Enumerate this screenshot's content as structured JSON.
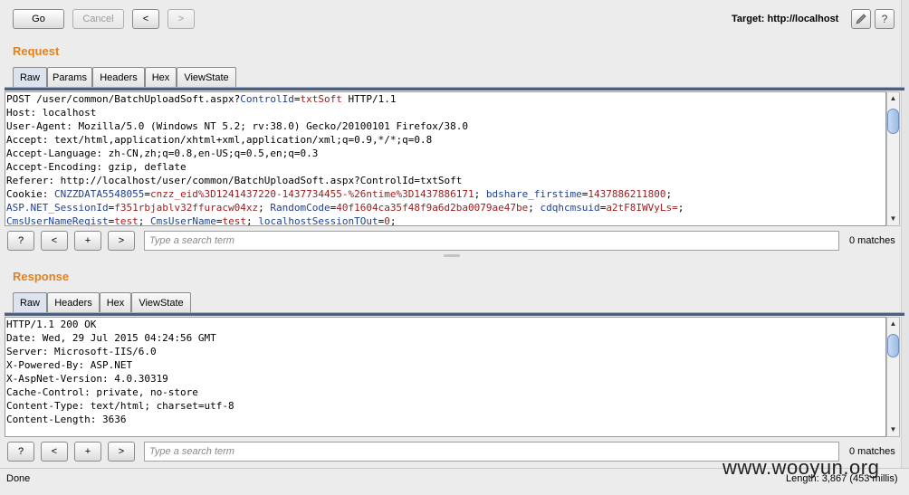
{
  "toolbar": {
    "go_label": "Go",
    "cancel_label": "Cancel",
    "back_label": "<",
    "forward_label": ">",
    "target_label": "Target: http://localhost",
    "edit_icon": "pencil-icon",
    "help_label": "?"
  },
  "request": {
    "title": "Request",
    "tabs": [
      "Raw",
      "Params",
      "Headers",
      "Hex",
      "ViewState"
    ],
    "active_tab": "Raw",
    "lines": [
      "POST /user/common/BatchUploadSoft.aspx?",
      "Host: localhost",
      "User-Agent: Mozilla/5.0 (Windows NT 5.2; rv:38.0) Gecko/20100101 Firefox/38.0",
      "Accept: text/html,application/xhtml+xml,application/xml;q=0.9,*/*;q=0.8",
      "Accept-Language: zh-CN,zh;q=0.8,en-US;q=0.5,en;q=0.3",
      "Accept-Encoding: gzip, deflate",
      "Referer: http://localhost/user/common/BatchUploadSoft.aspx?ControlId=txtSoft"
    ],
    "line0_param_name": "ControlId",
    "line0_param_eq": "=",
    "line0_param_value": "txtSoft",
    "line0_protocol": " HTTP/1.1",
    "cookie_prefix": "Cookie: ",
    "cookies": {
      "c1_name": "CNZZDATA5548055",
      "c1_value": "cnzz_eid%3D1241437220-1437734455-%26ntime%3D1437886171",
      "c2_name": "bdshare_firstime",
      "c2_value": "1437886211800",
      "c3_name": "ASP.NET_SessionId",
      "c3_value": "f351rbjablv32ffuracw04xz",
      "c4_name": "RandomCode",
      "c4_value": "40f1604ca35f48f9a6d2ba0079ae47be",
      "c5_name": "cdqhcmsuid",
      "c5_value": "a2tF8IWVyLs=",
      "c6_name": "CmsUserNameRegist",
      "c6_value": "test",
      "c7_name": "CmsUserName",
      "c7_value": "test",
      "c8_name": "localhostSessionTOut",
      "c8_value": "0"
    },
    "search": {
      "help_label": "?",
      "prev_label": "<",
      "add_label": "+",
      "next_label": ">",
      "placeholder": "Type a search term",
      "matches": "0 matches"
    }
  },
  "response": {
    "title": "Response",
    "tabs": [
      "Raw",
      "Headers",
      "Hex",
      "ViewState"
    ],
    "active_tab": "Raw",
    "lines": [
      "HTTP/1.1 200 OK",
      "Date: Wed, 29 Jul 2015 04:24:56 GMT",
      "Server: Microsoft-IIS/6.0",
      "X-Powered-By: ASP.NET",
      "X-AspNet-Version: 4.0.30319",
      "Cache-Control: private, no-store",
      "Content-Type: text/html; charset=utf-8",
      "Content-Length: 3636"
    ],
    "search": {
      "help_label": "?",
      "prev_label": "<",
      "add_label": "+",
      "next_label": ">",
      "placeholder": "Type a search term",
      "matches": "0 matches"
    }
  },
  "status": {
    "left": "Done",
    "right": "Length: 3,867 (453 millis)"
  },
  "watermark": "www.wooyun.org",
  "colors": {
    "section_title": "#e0821e",
    "cookie_name": "#1e3f93",
    "cookie_value": "#a11c1c"
  }
}
